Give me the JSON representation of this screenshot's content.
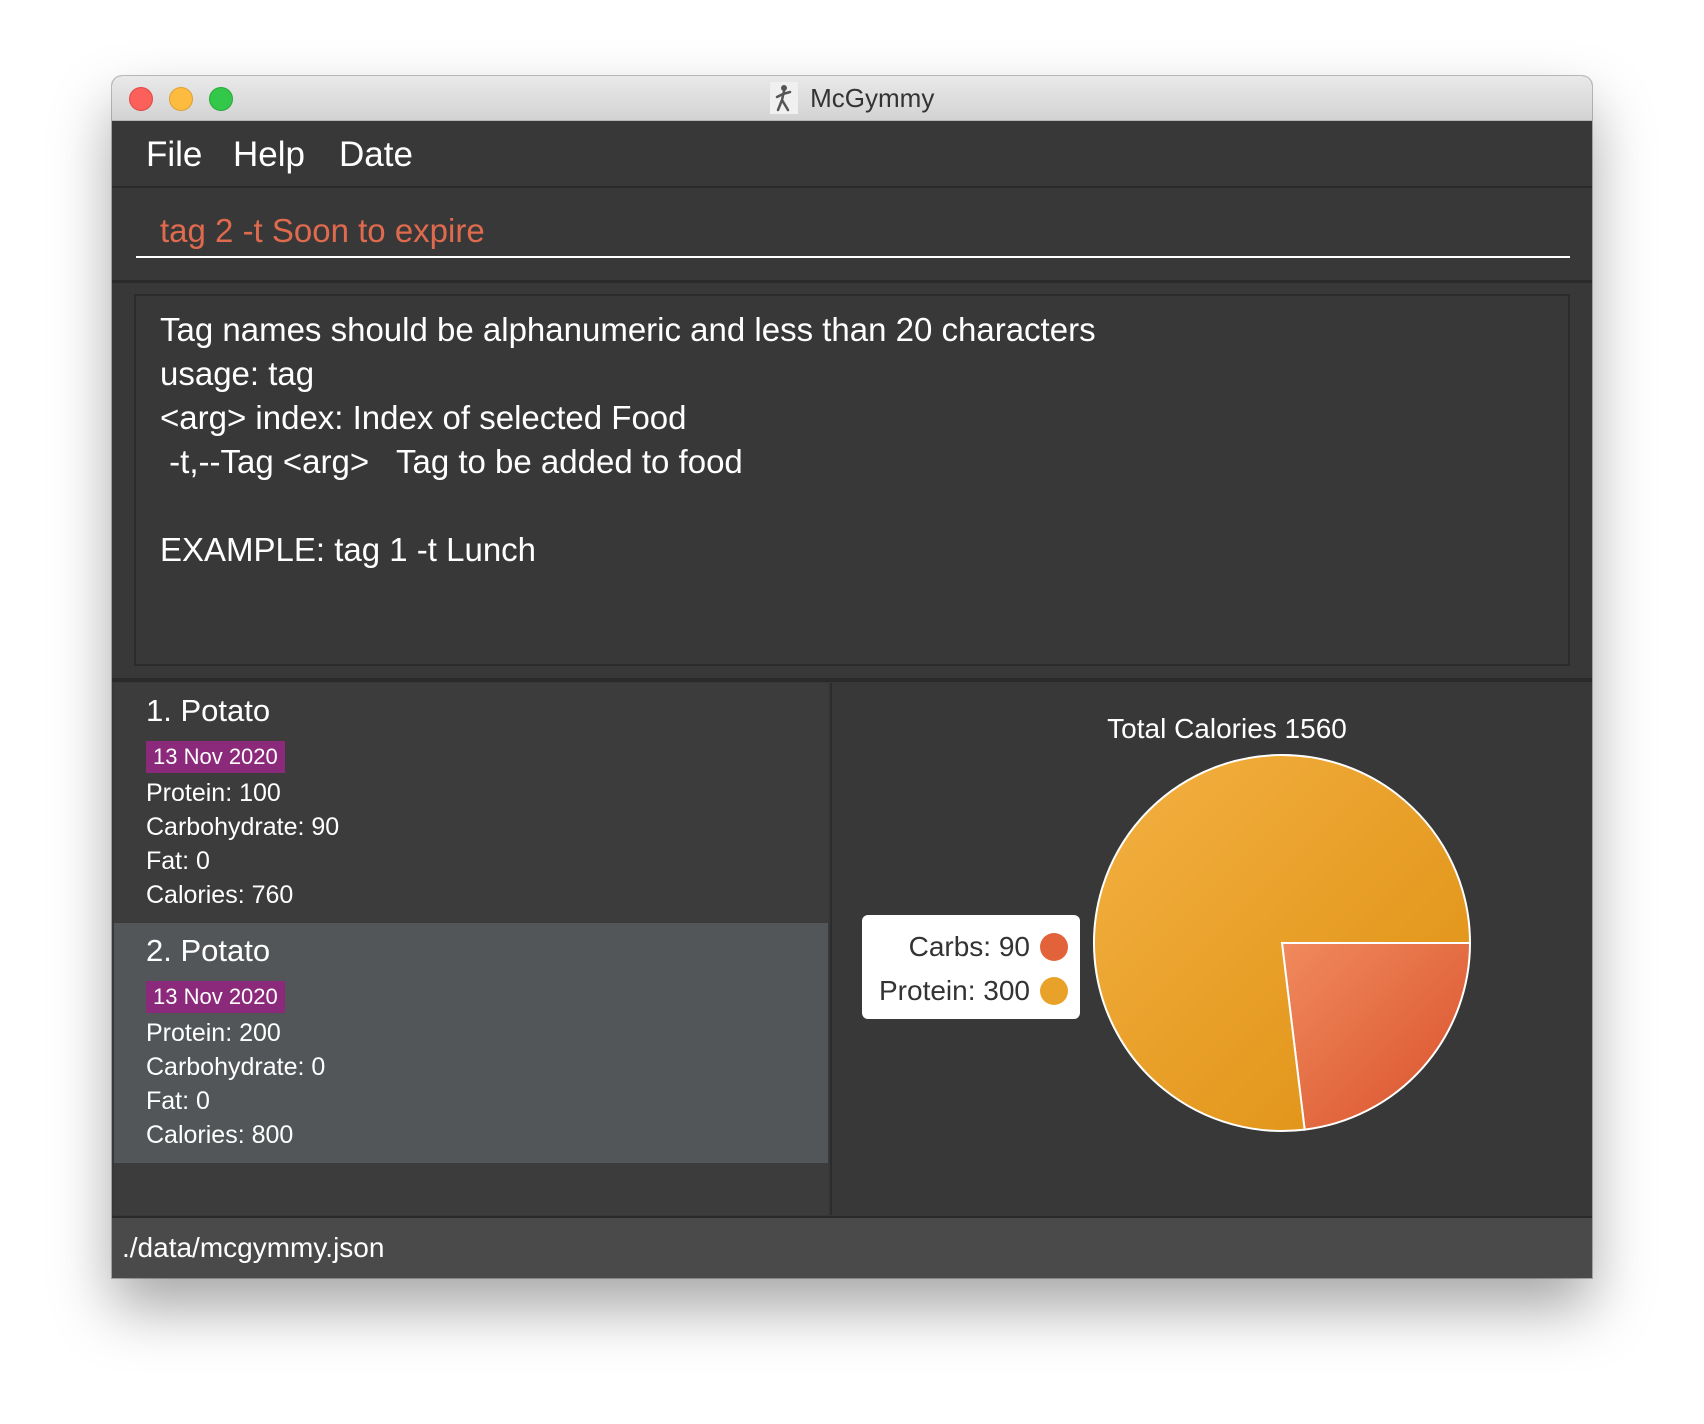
{
  "window": {
    "title": "McGymmy"
  },
  "menu": {
    "file": "File",
    "help": "Help",
    "date": "Date"
  },
  "command": {
    "value": "tag 2 -t Soon to expire"
  },
  "result": {
    "lines": [
      "Tag names should be alphanumeric and less than 20 characters",
      "usage: tag",
      "<arg> index: Index of selected Food",
      " -t,--Tag <arg>   Tag to be added to food",
      "",
      "EXAMPLE: tag 1 -t Lunch"
    ]
  },
  "foods": [
    {
      "name": "1.  Potato",
      "tag": "13 Nov 2020",
      "protein": "Protein: 100",
      "carbs": "Carbohydrate: 90",
      "fat": "Fat: 0",
      "calories": "Calories: 760",
      "selected": false
    },
    {
      "name": "2.  Potato",
      "tag": "13 Nov 2020",
      "protein": "Protein: 200",
      "carbs": "Carbohydrate: 0",
      "fat": "Fat: 0",
      "calories": "Calories: 800",
      "selected": true
    }
  ],
  "chart_data": {
    "type": "pie",
    "title": "Total Calories 1560",
    "slices": [
      {
        "label": "Carbs: 90",
        "value": 90,
        "color": "#e2633a"
      },
      {
        "label": "Protein: 300",
        "value": 300,
        "color": "#e8a22a"
      }
    ],
    "legend_placement": "left"
  },
  "status": {
    "path": "./data/mcgymmy.json"
  }
}
